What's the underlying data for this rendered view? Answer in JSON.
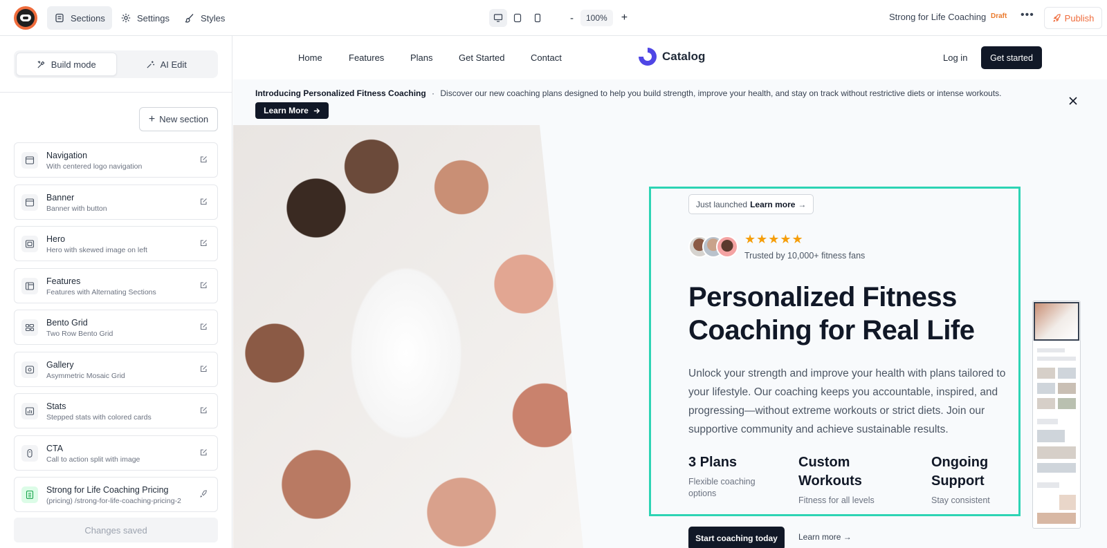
{
  "topbar": {
    "tabs": [
      {
        "label": "Sections",
        "icon": "sections-icon"
      },
      {
        "label": "Settings",
        "icon": "gear-icon"
      },
      {
        "label": "Styles",
        "icon": "brush-icon"
      }
    ],
    "zoom_minus": "-",
    "zoom": "100%",
    "zoom_plus": "+",
    "project_name": "Strong for Life Coaching",
    "status": "Draft",
    "more": "•••",
    "publish_label": "Publish"
  },
  "sidebar": {
    "modes": [
      {
        "label": "Build mode",
        "active": true
      },
      {
        "label": "AI Edit",
        "active": false
      }
    ],
    "new_section_label": "New section",
    "sections": [
      {
        "title": "Navigation",
        "subtitle": "With centered logo navigation"
      },
      {
        "title": "Banner",
        "subtitle": "Banner with button"
      },
      {
        "title": "Hero",
        "subtitle": "Hero with skewed image on left"
      },
      {
        "title": "Features",
        "subtitle": "Features with Alternating Sections"
      },
      {
        "title": "Bento Grid",
        "subtitle": "Two Row Bento Grid"
      },
      {
        "title": "Gallery",
        "subtitle": "Asymmetric Mosaic Grid"
      },
      {
        "title": "Stats",
        "subtitle": "Stepped stats with colored cards"
      },
      {
        "title": "CTA",
        "subtitle": "Call to action split with image"
      },
      {
        "title": "Strong for Life Coaching Pricing",
        "subtitle": "(pricing) /strong-for-life-coaching-pricing-2"
      }
    ],
    "saved_status": "Changes saved"
  },
  "site": {
    "nav_links": [
      "Home",
      "Features",
      "Plans",
      "Get Started",
      "Contact"
    ],
    "brand": "Catalog",
    "login": "Log in",
    "cta": "Get started",
    "banner": {
      "title": "Introducing Personalized Fitness Coaching",
      "separator": "·",
      "text": "Discover our new coaching plans designed to help you build strength, improve your health, and stay on track without restrictive diets or intense workouts.",
      "button": "Learn More"
    },
    "hero": {
      "pill_text": "Just launched",
      "pill_link": "Learn more",
      "stars": "★★★★★",
      "trusted": "Trusted by 10,000+ fitness fans",
      "headline": "Personalized Fitness Coaching for Real Life",
      "description": "Unlock your strength and improve your health with plans tailored to your lifestyle. Our coaching keeps you accountable, inspired, and progressing—without extreme workouts or strict diets. Join our supportive community and achieve sustainable results.",
      "stats": [
        {
          "title": "3 Plans",
          "subtitle": "Flexible coaching options"
        },
        {
          "title": "Custom Workouts",
          "subtitle": "Fitness for all levels"
        },
        {
          "title": "Ongoing Support",
          "subtitle": "Stay consistent"
        }
      ],
      "primary_cta": "Start coaching today",
      "secondary_cta": "Learn more →"
    }
  },
  "colors": {
    "accent": "#ef6c3c",
    "selection": "#2dd4b4",
    "dark": "#111827"
  }
}
